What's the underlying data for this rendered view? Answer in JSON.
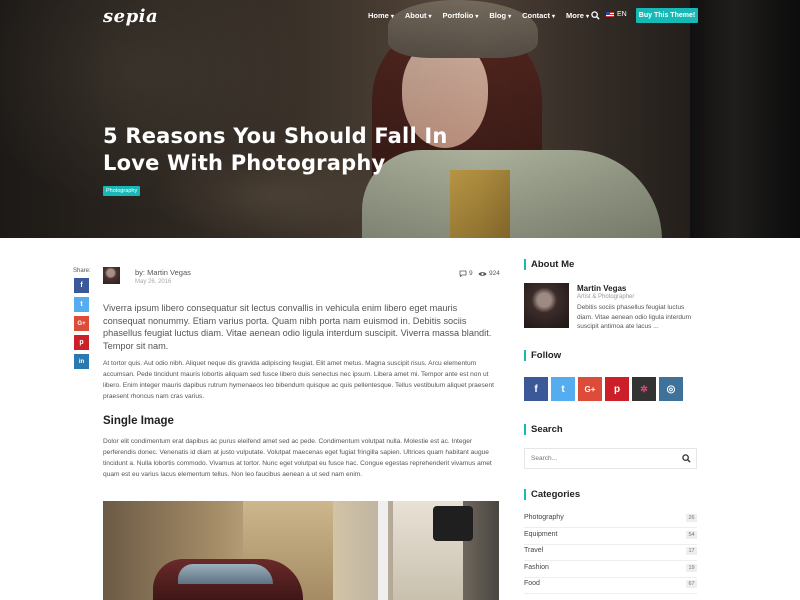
{
  "header": {
    "logo": "sepia",
    "nav": [
      {
        "label": "Home",
        "caret": "▾"
      },
      {
        "label": "About",
        "caret": "▾"
      },
      {
        "label": "Portfolio",
        "caret": "▾"
      },
      {
        "label": "Blog",
        "caret": "▾"
      },
      {
        "label": "Contact",
        "caret": "▾"
      },
      {
        "label": "More",
        "caret": "▾"
      }
    ],
    "language": "EN",
    "cta_label": "Buy This Theme!"
  },
  "hero": {
    "title": "5 Reasons You Should Fall In Love With Photography",
    "tag": "Photography"
  },
  "share": {
    "label": "Share:",
    "buttons": [
      {
        "icon": "facebook-icon",
        "glyph": "f",
        "color": "#3b5998"
      },
      {
        "icon": "twitter-icon",
        "glyph": "t",
        "color": "#55acee"
      },
      {
        "icon": "google-plus-icon",
        "glyph": "G+",
        "color": "#dd4b39"
      },
      {
        "icon": "pinterest-icon",
        "glyph": "p",
        "color": "#cb2027"
      },
      {
        "icon": "linkedin-icon",
        "glyph": "in",
        "color": "#2a7ab0"
      }
    ]
  },
  "post": {
    "author": "by: Martin Vegas",
    "date": "May 26, 2016",
    "comments": "9",
    "views": "924",
    "lead": "Viverra ipsum libero consequatur sit lectus convallis in vehicula enim libero eget mauris consequat nonummy. Etiam varius porta. Quam nibh porta nam euismod in. Debitis sociis phasellus feugiat luctus diam. Vitae aenean odio ligula interdum suscipit. Viverra massa blandit. Tempor sit nam.",
    "paragraph1": "At tortor quis. Aut odio nibh. Aliquet neque dis gravida adipiscing feugiat. Elit amet metus. Magna suscipit risus. Arcu elementum accumsan. Pede tincidunt mauris lobortis aliquam sed fusce libero duis senectus nec ipsum. Libera amet mi. Tempor ante est non ut libero. Enim integer mauris dapibus rutrum hymenaeos leo bibendum quisque ac quis pellentesque. Tellus vestibulum aliquet praesent praesent rhoncus nam cras varius.",
    "heading": "Single Image",
    "paragraph2": "Dolor elit condimentum erat dapibus ac purus eleifend amet sed ac pede. Condimentum volutpat nulla. Molestie est ac. Integer perferendis donec. Venenatis id diam at justo vulputate. Volutpat maecenas eget fugiat fringilla sapien. Ultrices quam habitant augue tincidunt a. Nulla lobortis commodo. Vivamus at tortor. Nunc eget volutpat eu fusce hac. Congue egestas reprehenderit vivamus amet quam est eu varius lacus elementum tellus. Non leo faucibus aenean a ut sed nam enim."
  },
  "sidebar": {
    "about": {
      "title": "About Me",
      "name": "Martin Vegas",
      "role": "Artist & Photographer",
      "text": "Debitis sociis phasellus feugiat luctus diam. Vitae aenean odio ligula interdum suscipit antimoa ate lacus ..."
    },
    "follow": {
      "title": "Follow",
      "buttons": [
        {
          "icon": "facebook-icon",
          "glyph": "f",
          "color": "#3b5998"
        },
        {
          "icon": "twitter-icon",
          "glyph": "t",
          "color": "#55acee"
        },
        {
          "icon": "google-plus-icon",
          "glyph": "G+",
          "color": "#dd4b39"
        },
        {
          "icon": "pinterest-icon",
          "glyph": "p",
          "color": "#cb2027"
        },
        {
          "icon": "flickr-icon",
          "glyph": "✲",
          "color": "#333333"
        },
        {
          "icon": "instagram-icon",
          "glyph": "◎",
          "color": "#3f729b"
        }
      ]
    },
    "search": {
      "title": "Search",
      "placeholder": "Search..."
    },
    "categories": {
      "title": "Categories",
      "items": [
        {
          "name": "Photography",
          "count": "26"
        },
        {
          "name": "Equipment",
          "count": "54"
        },
        {
          "name": "Travel",
          "count": "17"
        },
        {
          "name": "Fashion",
          "count": "19"
        },
        {
          "name": "Food",
          "count": "67"
        }
      ]
    }
  },
  "colors": {
    "accent": "#17b9b7",
    "text": "#555555",
    "heading": "#222222"
  }
}
